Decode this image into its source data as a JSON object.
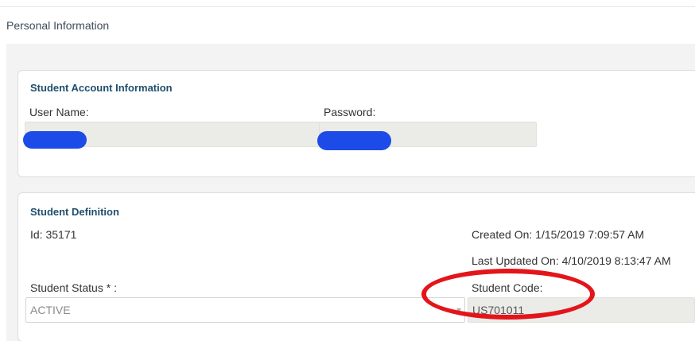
{
  "header": {
    "title": "Personal Information"
  },
  "student_account": {
    "heading": "Student Account Information",
    "username_label": "User Name:",
    "password_label": "Password:"
  },
  "student_definition": {
    "heading": "Student Definition",
    "id_text": "Id: 35171",
    "created_on": "Created On: 1/15/2019 7:09:57 AM",
    "last_updated_on": "Last Updated On: 4/10/2019 8:13:47 AM",
    "status_label": "Student Status * :",
    "status_value": "ACTIVE",
    "code_label": "Student Code:",
    "code_value": "US701011"
  },
  "colors": {
    "heading": "#1f4e6e",
    "annotation_circle": "#e3151b",
    "redaction": "#1d4be8"
  }
}
